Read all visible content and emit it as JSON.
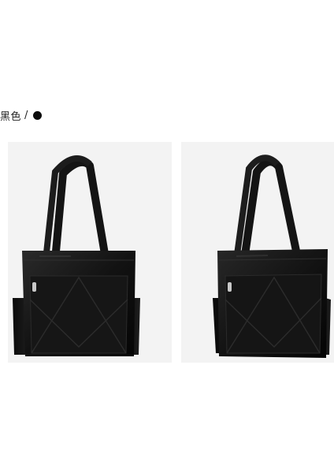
{
  "variant": {
    "color_name": "黑色",
    "separator": "/",
    "swatch_color": "#0d0d0d"
  },
  "images": [
    {
      "name": "handbag-front-view",
      "icon": "tote-bag-front"
    },
    {
      "name": "handbag-angled-view",
      "icon": "tote-bag-angled"
    }
  ],
  "colors": {
    "background": "#ffffff",
    "panel": "#f3f3f3",
    "bag": "#121212"
  }
}
